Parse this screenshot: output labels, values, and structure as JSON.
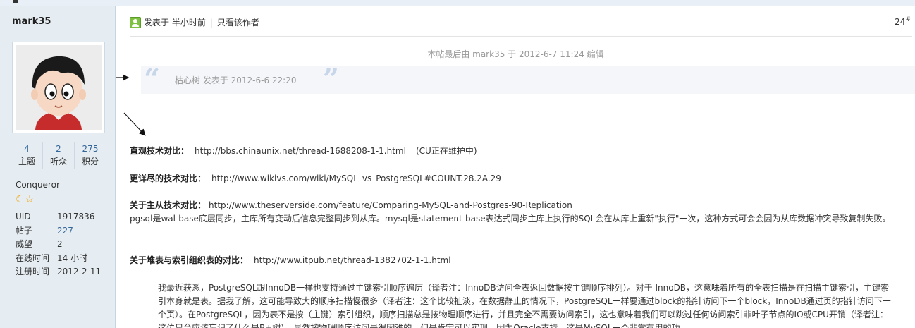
{
  "sidebar": {
    "username": "mark35",
    "stats": [
      {
        "num": "4",
        "label": "主题"
      },
      {
        "num": "2",
        "label": "听众"
      },
      {
        "num": "275",
        "label": "积分"
      }
    ],
    "rank": "Conqueror",
    "profile": [
      {
        "key": "UID",
        "value": "1917836"
      },
      {
        "key": "帖子",
        "value": "227"
      },
      {
        "key": "威望",
        "value": "2"
      },
      {
        "key": "在线时间",
        "value": "14 小时"
      },
      {
        "key": "注册时间",
        "value": "2012-2-11"
      }
    ]
  },
  "post": {
    "posted_at": "发表于 半小时前",
    "only_author": "只看该作者",
    "floor": "24",
    "floor_mark": "#",
    "edited": "本帖最后由 mark35 于 2012-6-7 11:24 编辑",
    "quote": "枯心树 发表于 2012-6-6 22:20",
    "sections": [
      {
        "title": "直观技术对比：",
        "url": "http://bbs.chinaunix.net/thread-1688208-1-1.html",
        "note": "(CU正在维护中)"
      },
      {
        "title": "更详尽的技术对比：",
        "url": "http://www.wikivs.com/wiki/MySQL_vs_PostgreSQL#COUNT.28.2A.29",
        "note": ""
      },
      {
        "title": "关于主从技术对比：",
        "url": "http://www.theserverside.com/feature/Comparing-MySQL-and-Postgres-90-Replication",
        "note": ""
      },
      {
        "title": "关于堆表与索引组织表的对比：",
        "url": "http://www.itpub.net/thread-1382702-1-1.html",
        "note": ""
      }
    ],
    "replication_text": "pgsql是wal-base底层同步，主库所有变动后信息完整同步到从库。mysql是statement-base表达式同步主库上执行的SQL会在从库上重新\"执行\"一次，这种方式可会会因为从库数据冲突导致复制失败。",
    "indent_text": "我最近获悉，PostgreSQL跟InnoDB一样也支持通过主键索引顺序遍历（译者注：InnoDB访问全表返回数据按主键顺序排列）。对于 InnoDB，这意味着所有的全表扫描是在扫描主键索引，主键索引本身就是表。据我了解，这可能导致大的顺序扫描慢很多（译者注：这个比较扯淡，在数据静止的情况下，PostgreSQL一样要通过block的指针访问下一个block，InnoDB通过页的指针访问下一个页）。在PostgreSQL，因为表不是按（主键）索引组织，顺序扫描总是按物理顺序进行，并且完全不需要访问索引，这也意味着我们可以跳过任何访问索引非叶子节点的IO或CPU开销（译者注：这位兄台应该忘记了什么是B+树）。显然按物理顺序访问是很困难的，但是肯定可以实现，因为Oracle支持。这是MySQL一个非常有用的功"
  }
}
